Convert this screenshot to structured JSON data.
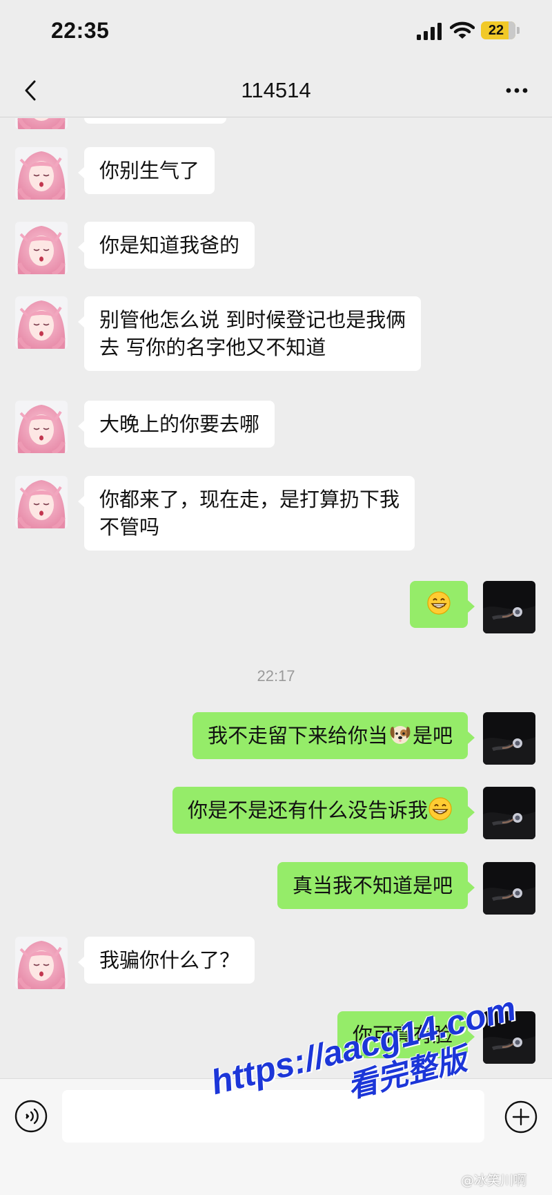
{
  "status_bar": {
    "time": "22:35",
    "battery": "22",
    "icons": [
      "signal-icon",
      "wifi-icon",
      "battery-icon"
    ]
  },
  "nav": {
    "title": "114514",
    "back_icon": "chevron-left-icon",
    "more_icon": "more-dots-icon"
  },
  "messages": [
    {
      "side": "left",
      "text": "你别生气了"
    },
    {
      "side": "left",
      "text": "你是知道我爸的"
    },
    {
      "side": "left",
      "line1": "别管他怎么说 到时候登记也是我俩",
      "line2": "去 写你的名字他又不知道"
    },
    {
      "side": "left",
      "text": "大晚上的你要去哪"
    },
    {
      "side": "left",
      "line1": "你都来了，现在走，是打算扔下我",
      "line2": "不管吗"
    },
    {
      "side": "right",
      "emoji": "grinning-face-emoji"
    },
    {
      "divider": "22:17"
    },
    {
      "side": "right",
      "before": "我不走留下来给你当",
      "emoji": "dog-face-emoji",
      "after": "是吧"
    },
    {
      "side": "right",
      "text": "你是不是还有什么没告诉我",
      "emoji": "grinning-face-emoji"
    },
    {
      "side": "right",
      "text": "真当我不知道是吧"
    },
    {
      "side": "left",
      "text": "我骗你什么了？"
    },
    {
      "side": "right",
      "text": "你可真有脸"
    }
  ],
  "input_bar": {
    "voice_icon": "voice-icon",
    "plus_icon": "plus-circle-icon",
    "value": ""
  },
  "watermark": {
    "url": "https://aacg14.com",
    "subtitle": "看完整版"
  },
  "credit": "@冰笑川啊",
  "colors": {
    "background": "#ededed",
    "outgoing_bubble": "#95ec69",
    "incoming_bubble": "#ffffff",
    "watermark": "#1c36d8",
    "battery": "#f1c928"
  }
}
